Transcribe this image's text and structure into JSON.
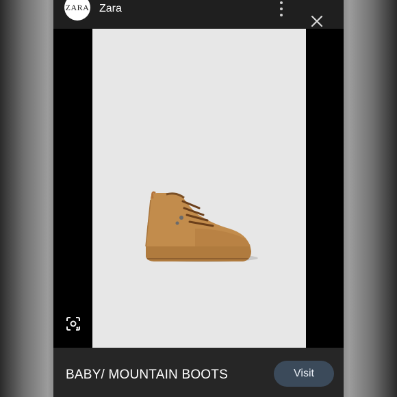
{
  "header": {
    "logo_text": "ZARA",
    "brand_name": "Zara",
    "menu_icon": "more-vert-icon",
    "close_icon": "close-icon"
  },
  "viewer": {
    "background_color": "#e7e7e7",
    "lens_icon": "lens-icon",
    "image_subject": "boot"
  },
  "footer": {
    "product_title": "BABY/ MOUNTAIN BOOTS",
    "visit_label": "Visit",
    "visit_color": "#3b4a5a"
  }
}
